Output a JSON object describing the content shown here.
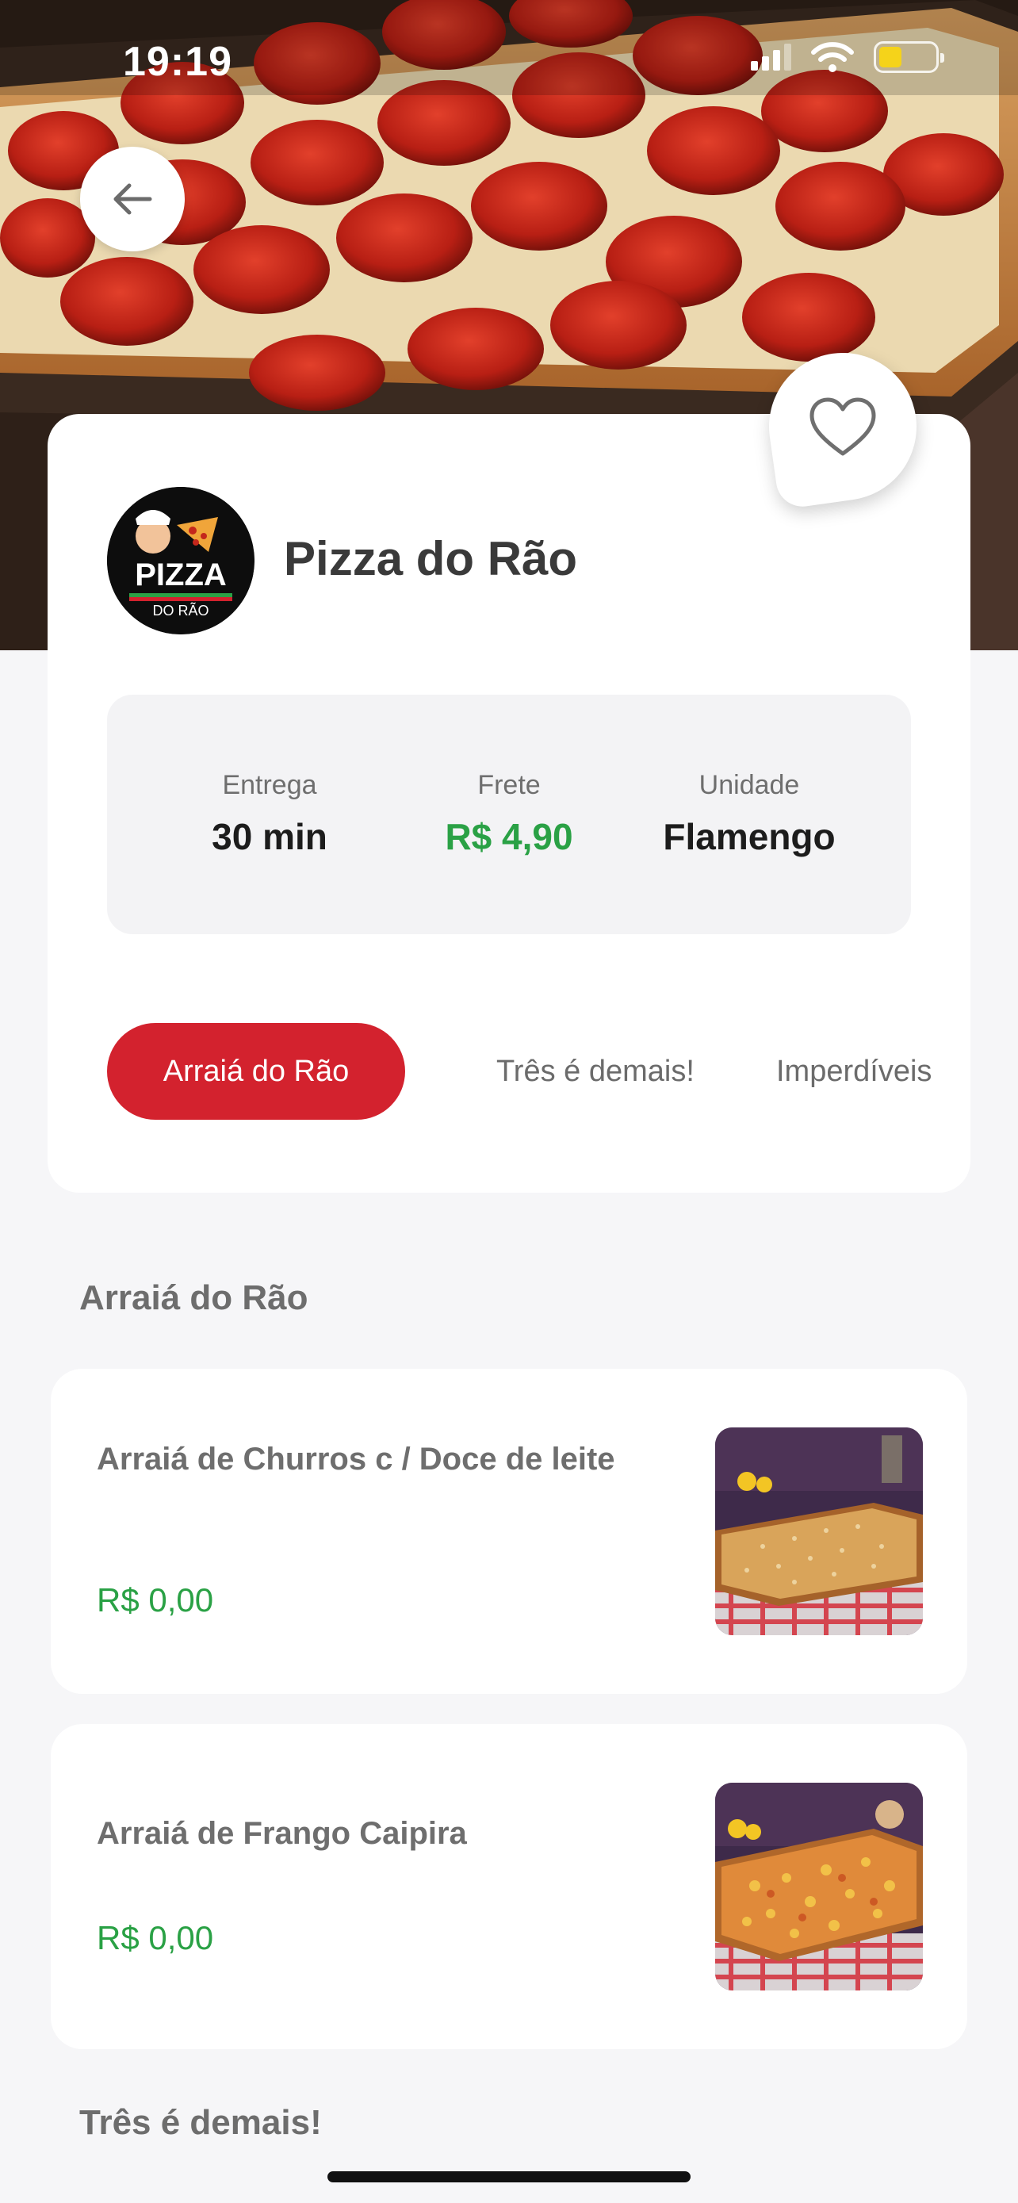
{
  "status_bar": {
    "time": "19:19"
  },
  "restaurant": {
    "name": "Pizza do Rão",
    "logo_text": "PIZZA",
    "logo_subtext": "DO RÃO"
  },
  "info": [
    {
      "label": "Entrega",
      "value": "30 min"
    },
    {
      "label": "Frete",
      "value": "R$ 4,90"
    },
    {
      "label": "Unidade",
      "value": "Flamengo"
    }
  ],
  "tabs": [
    {
      "label": "Arraiá do Rão",
      "active": true
    },
    {
      "label": "Três é demais!",
      "active": false
    },
    {
      "label": "Imperdíveis",
      "active": false
    }
  ],
  "sections": [
    {
      "title": "Arraiá do Rão",
      "items": [
        {
          "name": "Arraiá de Churros c / Doce de leite",
          "price": "R$ 0,00"
        },
        {
          "name": "Arraiá de Frango Caipira",
          "price": "R$ 0,00"
        }
      ]
    },
    {
      "title": "Três é demais!",
      "items": []
    }
  ],
  "colors": {
    "accent_red": "#d3222e",
    "price_green": "#2aa145",
    "background": "#f6f6f8"
  },
  "icons": {
    "back": "arrow-left-icon",
    "favorite": "heart-outline-icon"
  }
}
